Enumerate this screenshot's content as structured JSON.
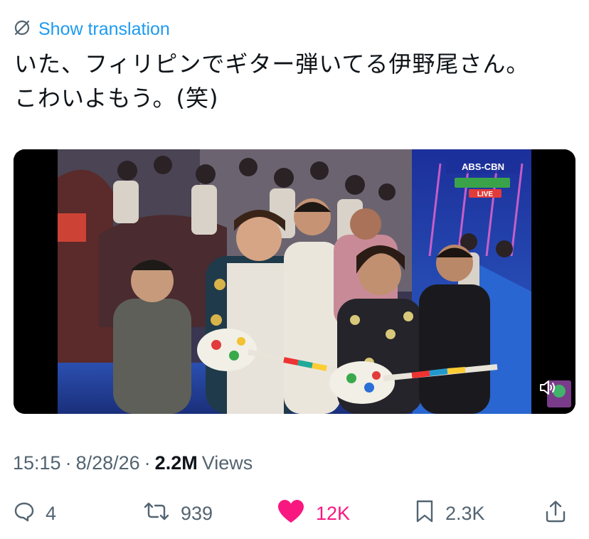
{
  "translate": {
    "label": "Show translation"
  },
  "tweet": {
    "text": "いた、フィリピンでギター弾いてる伊野尾さん。\nこわいよもう。(笑)"
  },
  "video": {
    "broadcaster": "ABS-CBN",
    "badge_line": "LIVE",
    "audio_icon": "speaker-muted-icon"
  },
  "meta": {
    "time": "15:15",
    "date": "8/28/26",
    "views_count": "2.2M",
    "views_label": "Views"
  },
  "actions": {
    "replies": "4",
    "reposts": "939",
    "likes": "12K",
    "bookmarks": "2.3K"
  },
  "colors": {
    "link": "#1d9bf0",
    "like": "#f91880",
    "muted_text": "#536471"
  }
}
